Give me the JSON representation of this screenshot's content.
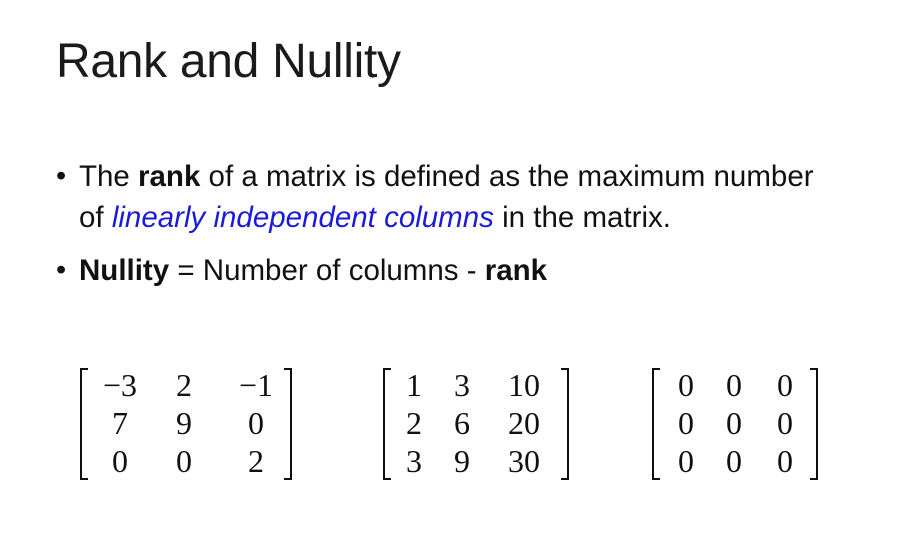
{
  "slide": {
    "title": "Rank and Nullity",
    "bullets": [
      {
        "marker": "•",
        "pre": "The ",
        "bold": "rank",
        "mid": " of a matrix is defined as the maximum number of ",
        "highlight": "linearly independent columns",
        "post": " in the matrix."
      },
      {
        "marker": "•",
        "bold": "Nullity",
        "mid": " = Number of columns - ",
        "bold2": "rank"
      }
    ],
    "highlight_color": "#1a1adb",
    "matrices": [
      [
        [
          "−3",
          "2",
          "−1"
        ],
        [
          "7",
          "9",
          "0"
        ],
        [
          "0",
          "0",
          "2"
        ]
      ],
      [
        [
          "1",
          "3",
          "10"
        ],
        [
          "2",
          "6",
          "20"
        ],
        [
          "3",
          "9",
          "30"
        ]
      ],
      [
        [
          "0",
          "0",
          "0"
        ],
        [
          "0",
          "0",
          "0"
        ],
        [
          "0",
          "0",
          "0"
        ]
      ]
    ]
  }
}
